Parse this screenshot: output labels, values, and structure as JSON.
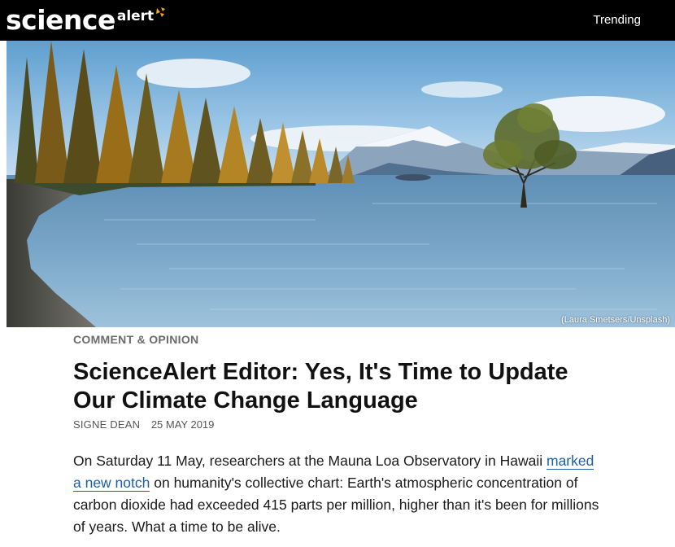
{
  "header": {
    "logo_science": "science",
    "logo_alert": "alert",
    "trending_label": "Trending"
  },
  "hero": {
    "caption": "(Laura Smetsers/Unsplash)"
  },
  "article": {
    "category": "COMMENT & OPINION",
    "headline": "ScienceAlert Editor: Yes, It's Time to Update Our Climate Change Language",
    "author": "SIGNE DEAN",
    "date": "25 MAY 2019",
    "paragraph": {
      "before_link": "On Saturday 11 May, researchers at the Mauna Loa Observatory in Hawaii ",
      "link_text": "marked a new notch",
      "after_link": " on humanity's collective chart: Earth's atmospheric concentration of carbon dioxide had exceeded 415 parts per million, higher than it's been for millions of years. What a time to be alive."
    }
  },
  "colors": {
    "header_bg": "#000000",
    "logo_spark": "#f5a623",
    "link": "#1a5fa8",
    "category": "#6c6c6c"
  }
}
